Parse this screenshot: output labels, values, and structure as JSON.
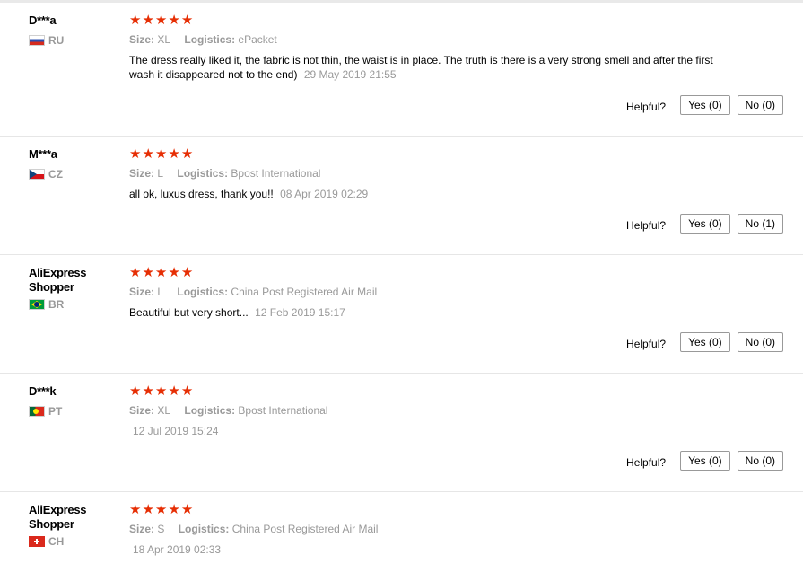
{
  "labels": {
    "size": "Size:",
    "logistics": "Logistics:",
    "helpful": "Helpful?"
  },
  "star_glyph": "★",
  "star_color": "#e62e04",
  "reviews": [
    {
      "name": "D***a",
      "country": "RU",
      "flag": "russia-flag",
      "rating": 5,
      "size": "XL",
      "logistics": "ePacket",
      "text": "The dress really liked it, the fabric is not thin, the waist is in place. The truth is there is a very strong smell and after the first wash it disappeared not to the end)",
      "date": "29 May 2019 21:55",
      "yes": "Yes (0)",
      "no": "No (0)"
    },
    {
      "name": "M***a",
      "country": "CZ",
      "flag": "czech-flag",
      "rating": 5,
      "size": "L",
      "logistics": "Bpost International",
      "text": "all ok, luxus dress, thank you!!",
      "date": "08 Apr 2019 02:29",
      "yes": "Yes (0)",
      "no": "No (1)"
    },
    {
      "name": "AliExpress Shopper",
      "country": "BR",
      "flag": "brazil-flag",
      "rating": 5,
      "size": "L",
      "logistics": "China Post Registered Air Mail",
      "text": "Beautiful but very short...",
      "date": "12 Feb 2019 15:17",
      "yes": "Yes (0)",
      "no": "No (0)"
    },
    {
      "name": "D***k",
      "country": "PT",
      "flag": "portugal-flag",
      "rating": 5,
      "size": "XL",
      "logistics": "Bpost International",
      "text": "",
      "date": "12 Jul 2019 15:24",
      "yes": "Yes (0)",
      "no": "No (0)"
    },
    {
      "name": "AliExpress Shopper",
      "country": "CH",
      "flag": "switzerland-flag",
      "rating": 5,
      "size": "S",
      "logistics": "China Post Registered Air Mail",
      "text": "",
      "date": "18 Apr 2019 02:33",
      "yes": "",
      "no": ""
    }
  ]
}
